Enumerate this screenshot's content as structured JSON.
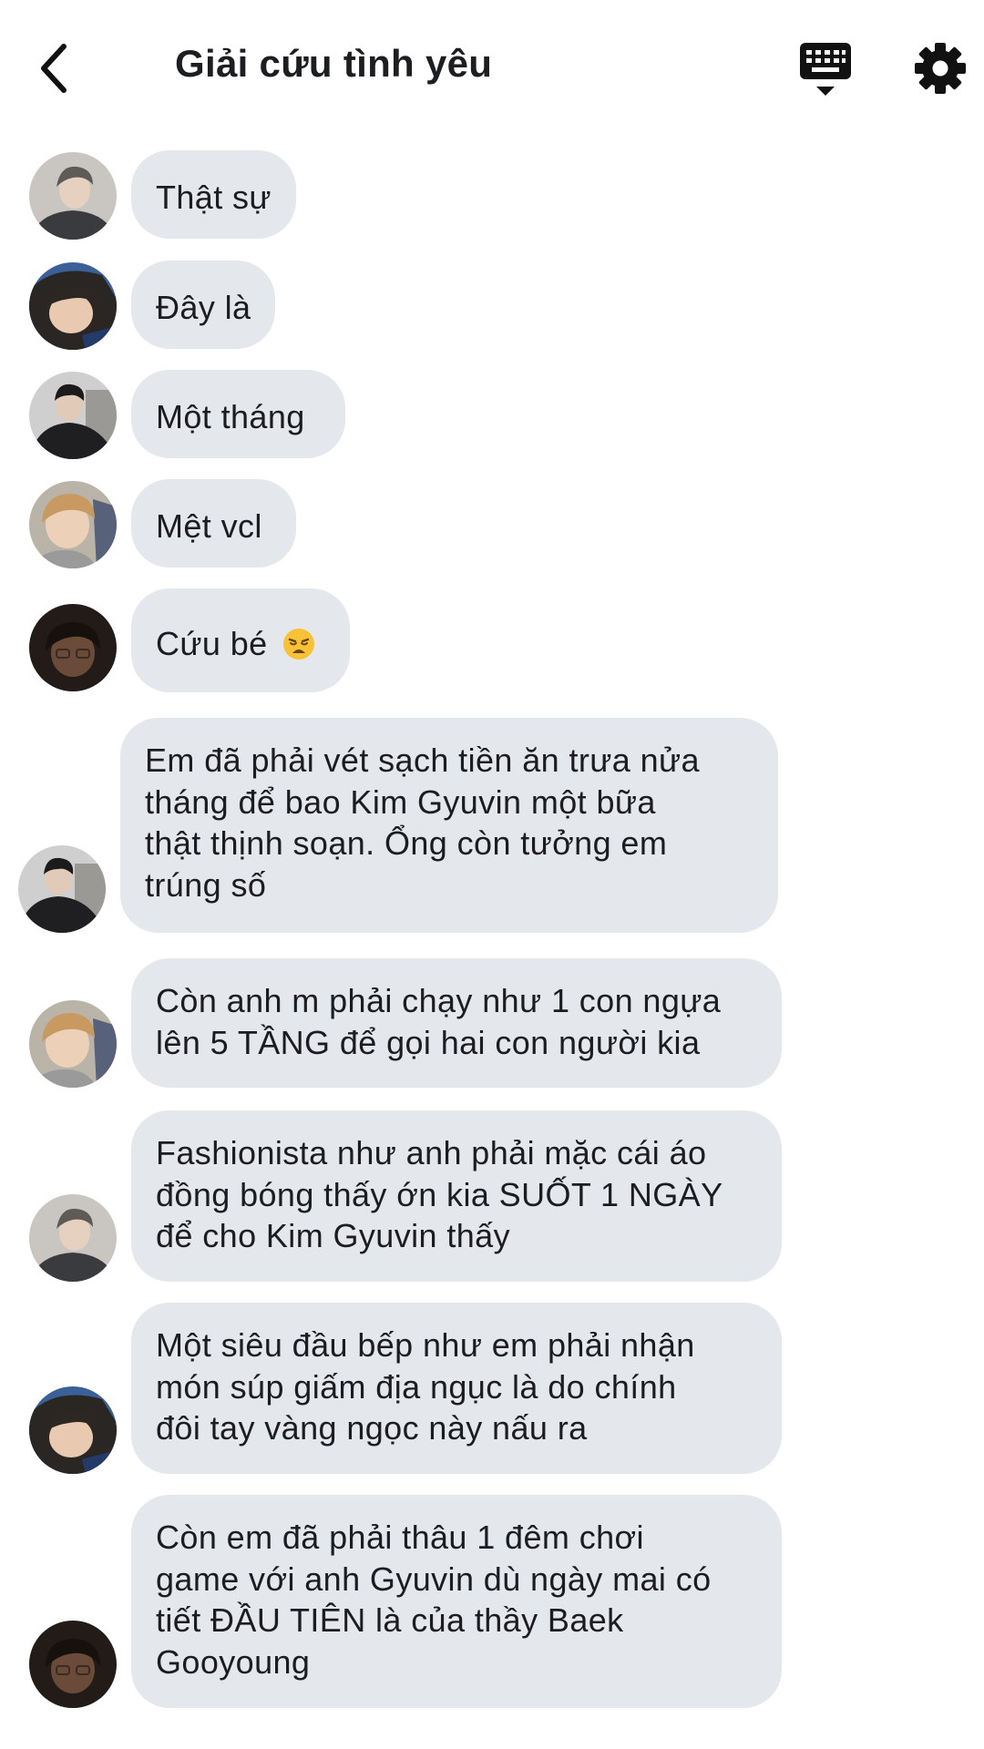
{
  "header": {
    "title": "Giải cứu tình yêu",
    "back_icon": "chevron-left-icon",
    "keyboard_icon": "keyboard-icon",
    "settings_icon": "gear-icon"
  },
  "colors": {
    "bubble": "#e4e7ec",
    "text": "#1b1d20",
    "background": "#ffffff"
  },
  "messages": [
    {
      "lines": [
        "Thật sự"
      ]
    },
    {
      "lines": [
        "Đây là"
      ]
    },
    {
      "lines": [
        "Một tháng"
      ]
    },
    {
      "lines": [
        "Mệt vcl"
      ]
    },
    {
      "lines": [
        "Cứu bé"
      ],
      "emoji": "weary-face-icon"
    },
    {
      "lines": [
        "Em đã phải vét sạch tiền ăn trưa nửa",
        "tháng để bao Kim Gyuvin một bữa",
        "thật thịnh soạn. Ổng còn tưởng em",
        "trúng số"
      ]
    },
    {
      "lines": [
        "Còn anh m phải chạy như 1 con ngựa",
        "lên 5 TẦNG để gọi hai con người kia"
      ]
    },
    {
      "lines": [
        "Fashionista như anh phải mặc cái áo",
        "đồng bóng thấy ớn kia SUỐT 1 NGÀY",
        "để cho Kim Gyuvin thấy"
      ]
    },
    {
      "lines": [
        "Một siêu đầu bếp như em phải nhận",
        "món súp giấm địa ngục là do chính",
        "đôi tay vàng ngọc này nấu ra"
      ]
    },
    {
      "lines": [
        "Còn em đã phải thâu 1 đêm chơi",
        "game với anh Gyuvin dù ngày mai có",
        "tiết ĐẦU TIÊN là của thầy Baek",
        "Gooyoung"
      ]
    }
  ]
}
